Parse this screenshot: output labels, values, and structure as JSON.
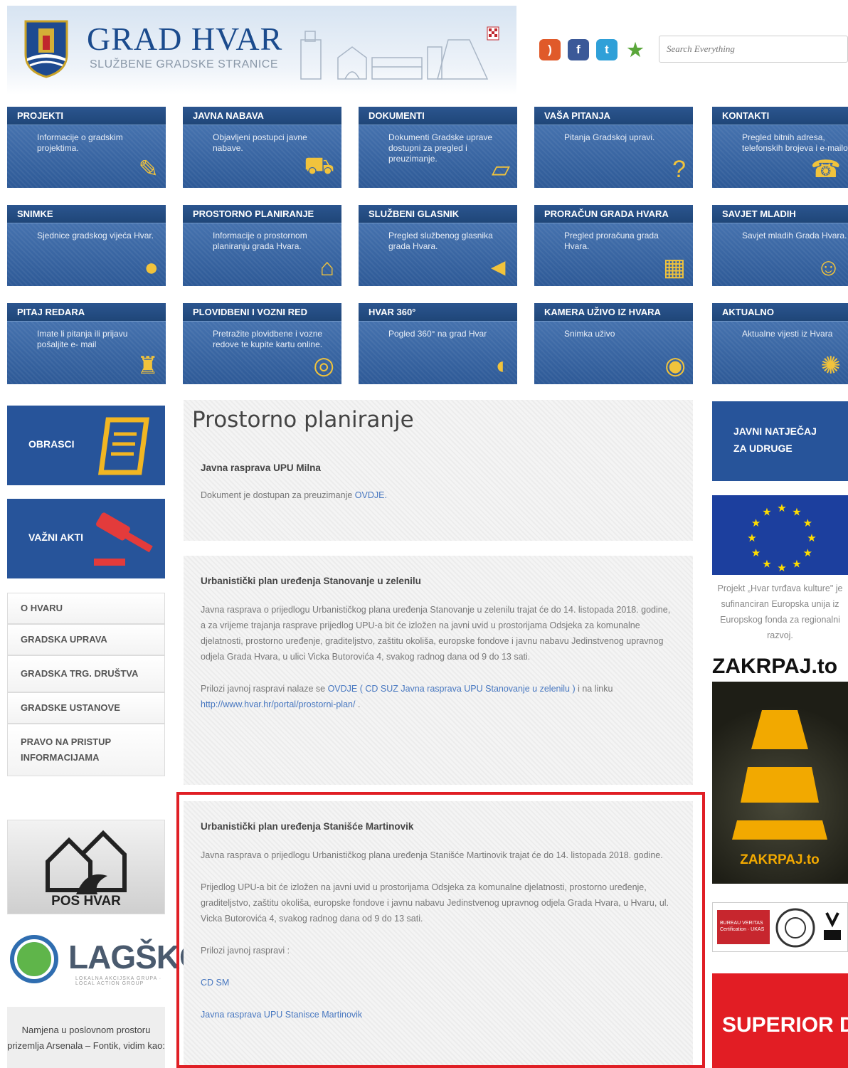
{
  "header": {
    "title": "GRAD HVAR",
    "subtitle": "SLUŽBENE GRADSKE STRANICE",
    "search_placeholder": "Search Everything"
  },
  "social": [
    "rss-icon",
    "facebook-icon",
    "twitter-icon",
    "star-icon"
  ],
  "tiles": [
    {
      "title": "PROJEKTI",
      "desc": "Informacije o gradskim projektima.",
      "icon": "tools-icon"
    },
    {
      "title": "JAVNA NABAVA",
      "desc": "Objavljeni postupci javne nabave.",
      "icon": "cart-icon"
    },
    {
      "title": "DOKUMENTI",
      "desc": "Dokumenti Gradske uprave dostupni za pregled i preuzimanje.",
      "icon": "folder-icon"
    },
    {
      "title": "VAŠA PITANJA",
      "desc": "Pitanja Gradskoj upravi.",
      "icon": "question-icon"
    },
    {
      "title": "KONTAKTI",
      "desc": "Pregled bitnih adresa, telefonskih brojeva i e-mailova.",
      "icon": "phone-icon"
    },
    {
      "title": "SNIMKE",
      "desc": "Sjednice gradskog vijeća Hvar.",
      "icon": "microphone-icon"
    },
    {
      "title": "PROSTORNO PLANIRANJE",
      "desc": "Informacije o prostornom planiranju grada Hvara.",
      "icon": "plan-icon"
    },
    {
      "title": "SLUŽBENI GLASNIK",
      "desc": "Pregled službenog glasnika grada Hvara.",
      "icon": "megaphone-icon"
    },
    {
      "title": "PRORAČUN GRADA HVARA",
      "desc": "Pregled proračuna grada Hvara.",
      "icon": "calculator-icon"
    },
    {
      "title": "SAVJET MLADIH",
      "desc": "Savjet mladih Grada Hvara.",
      "icon": "people-icon"
    },
    {
      "title": "PITAJ REDARA",
      "desc": "Imate li pitanja ili prijavu pošaljite e- mail",
      "icon": "warden-icon"
    },
    {
      "title": "PLOVIDBENI I VOZNI RED",
      "desc": "Pretražite plovidbene i vozne redove te kupite kartu online.",
      "icon": "wheel-icon"
    },
    {
      "title": "HVAR 360°",
      "desc": "Pogled 360° na grad Hvar",
      "icon": "panorama-icon"
    },
    {
      "title": "KAMERA UŽIVO IZ HVARA",
      "desc": "Snimka uživo",
      "icon": "webcam-icon"
    },
    {
      "title": "AKTUALNO",
      "desc": "Aktualne vijesti iz Hvara",
      "icon": "lightbulb-icon"
    }
  ],
  "left": {
    "obrasci": "OBRASCI",
    "vazni_akti": "VAŽNI AKTI",
    "nav": [
      "O HVARU",
      "GRADSKA UPRAVA",
      "GRADSKA TRG. DRUŠTVA",
      "GRADSKE USTANOVE",
      "PRAVO NA PRISTUP INFORMACIJAMA"
    ],
    "pos_label": "POS HVAR",
    "lag_text": "LAGŠKOJI",
    "lag_sub": "LOKALNA AKCIJSKA GRUPA · LOCAL ACTION GROUP",
    "note": "Namjena u poslovnom prostoru prizemlja Arsenala – Fontik, vidim kao:"
  },
  "main": {
    "page_title": "Prostorno planiranje",
    "sec1": {
      "heading": "Javna rasprava UPU Milna",
      "text": "Dokument je dostupan za preuzimanje ",
      "link": "OVDJE."
    },
    "sec2": {
      "heading": "Urbanistički plan uređenja Stanovanje u zelenilu",
      "p1": "Javna rasprava o prijedlogu Urbanističkog plana uređenja Stanovanje u zelenilu trajat će do 14. listopada 2018. godine, a za vrijeme trajanja rasprave prijedlog UPU-a bit će izložen na javni uvid u prostorijama Odsjeka za komunalne djelatnosti, prostorno uređenje, graditeljstvo, zaštitu okoliša, europske fondove i javnu nabavu Jedinstvenog upravnog odjela Grada Hvara, u ulici Vicka Butorovića 4, svakog radnog dana od 9 do 13 sati.",
      "p2_a": "Prilozi javnoj raspravi nalaze se ",
      "p2_link1": "OVDJE ( CD SUZ  Javna rasprava UPU Stanovanje u zelenilu )",
      "p2_b": " i na linku ",
      "p2_link2": "http://www.hvar.hr/portal/prostorni-plan/",
      "p2_c": " ."
    },
    "sec3": {
      "heading": "Urbanistički plan uređenja Stanišće Martinovik",
      "p1": "Javna rasprava o prijedlogu Urbanističkog plana uređenja Stanišće Martinovik trajat će do 14. listopada 2018. godine.",
      "p2": "Prijedlog UPU-a bit će izložen na javni uvid u prostorijama Odsjeka za komunalne djelatnosti, prostorno uređenje, graditeljstvo, zaštitu okoliša, europske fondove i javnu nabavu Jedinstvenog upravnog odjela Grada Hvara, u Hvaru, ul. Vicka Butorovića 4, svakog radnog dana od 9 do 13 sati.",
      "p3": "Prilozi javnoj raspravi :",
      "link1": "CD SM",
      "link2": "Javna rasprava UPU Stanisce Martinovik"
    }
  },
  "right": {
    "jn": "JAVNI NATJEČAJ ZA UDRUGE",
    "eu_caption": "Projekt „Hvar tvrđava kulture\" je sufinanciran Europska unija iz Europskog fonda za regionalni razvoj.",
    "zak_title": "ZAKRPAJ.to",
    "zak_logo": "ZAKRPAJ.to",
    "cert_text": "BUREAU VERITAS Certification · UKAS",
    "superior": "SUPERIOR DESTINATION"
  },
  "colors": {
    "tile": "#2e5a97",
    "accent": "#e21d24",
    "link": "#4777c0"
  }
}
